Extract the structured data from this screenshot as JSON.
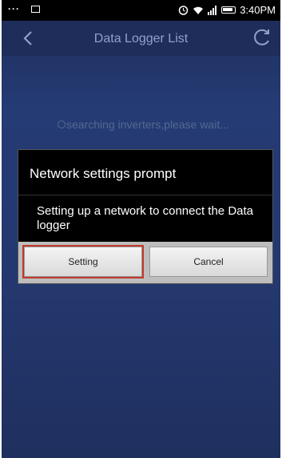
{
  "status_bar": {
    "left_icons": [
      "more-dots-icon",
      "image-icon"
    ],
    "right_icons": [
      "alarm-icon",
      "wifi-icon",
      "signal-icon",
      "battery-icon"
    ],
    "time": "3:40PM"
  },
  "nav": {
    "title": "Data Logger List",
    "back_icon": "chevron-left-icon",
    "refresh_icon": "refresh-icon"
  },
  "main": {
    "searching_text": "searching inverters,please wait..."
  },
  "dialog": {
    "title": "Network settings prompt",
    "message": "Setting up a network to connect the Data logger",
    "buttons": {
      "setting_label": "Setting",
      "cancel_label": "Cancel"
    }
  },
  "colors": {
    "background": "#24386f",
    "nav_bar": "#1e2d5a",
    "dialog_bg": "#000000",
    "highlight": "#c0392b"
  }
}
